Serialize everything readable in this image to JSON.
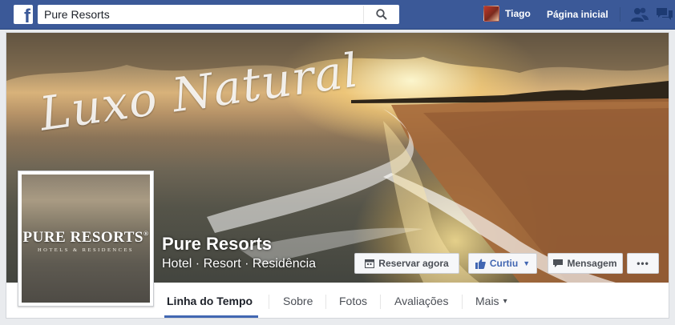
{
  "topbar": {
    "logo": "f",
    "search_value": "Pure Resorts",
    "search_icon": "magnifier-icon",
    "user_name": "Tiago",
    "home_label": "Página inicial",
    "icons": [
      "friends-icon",
      "messages-icon"
    ],
    "color": "#3b5998"
  },
  "cover": {
    "script_text": "Luxo Natural"
  },
  "profile_picture": {
    "logo_text": "PURE RESORTS",
    "logo_mark": "®",
    "logo_sub": "HOTELS & RESIDENCES"
  },
  "page": {
    "name": "Pure Resorts",
    "category": "Hotel · Resort · Residência"
  },
  "actions": {
    "book_label": "Reservar agora",
    "like_label": "Curtiu",
    "message_label": "Mensagem",
    "more_label": "•••"
  },
  "tabs": [
    {
      "label": "Linha do Tempo",
      "active": true
    },
    {
      "label": "Sobre"
    },
    {
      "label": "Fotos"
    },
    {
      "label": "Avaliações"
    },
    {
      "label": "Mais",
      "dropdown": "▾"
    }
  ],
  "colors": {
    "accent": "#4267b2",
    "like": "#4267b2"
  }
}
